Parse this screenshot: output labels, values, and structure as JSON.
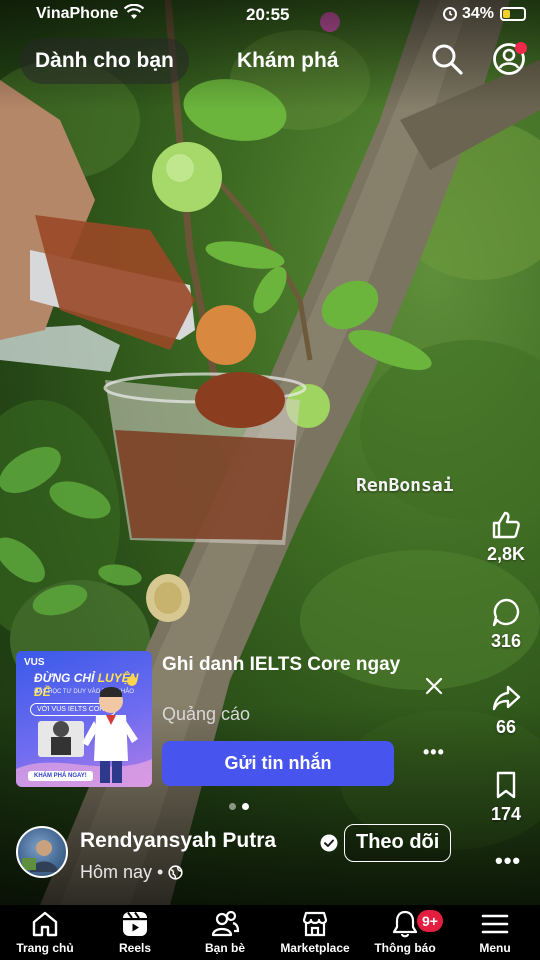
{
  "status_bar": {
    "carrier": "VinaPhone",
    "time": "20:55",
    "battery_percent": "34%",
    "battery_level": 0.34,
    "icons": [
      "wifi-icon",
      "alarm-icon",
      "battery-icon"
    ]
  },
  "top_tabs": {
    "for_you": "Dành cho bạn",
    "explore": "Khám phá",
    "icons": [
      "search-icon",
      "profile-icon"
    ]
  },
  "video": {
    "watermark": "RenBonsai"
  },
  "actions": {
    "like_count": "2,8K",
    "comment_count": "316",
    "share_count": "66",
    "save_count": "174",
    "icons": [
      "like-icon",
      "comment-icon",
      "share-icon",
      "save-icon",
      "more-icon"
    ]
  },
  "ad": {
    "thumb_brand": "VUS",
    "thumb_headline_a": "ĐỪNG CHỈ ",
    "thumb_headline_b": "LUYỆN ĐỀ",
    "thumb_subtext": "HÃY HỌC TƯ DUY VÀO ĐÂM KHẢO",
    "thumb_pill": "VỚI VUS IELTS CORE",
    "thumb_cta": "KHÁM PHÁ NGAY!",
    "title": "Ghi danh IELTS Core ngay",
    "sponsor": "Quảng cáo",
    "button": "Gửi tin nhắn",
    "carousel_pages": 2,
    "carousel_active": 2
  },
  "author": {
    "name": "Rendyansyah Putra",
    "follow": "Theo dõi",
    "posted": "Hôm nay •",
    "verified": true
  },
  "bottom_nav": {
    "items": [
      {
        "label": "Trang chủ",
        "icon": "home-icon"
      },
      {
        "label": "Reels",
        "icon": "reels-icon"
      },
      {
        "label": "Bạn bè",
        "icon": "friends-icon"
      },
      {
        "label": "Marketplace",
        "icon": "marketplace-icon"
      },
      {
        "label": "Thông báo",
        "icon": "bell-icon",
        "badge": "9+"
      },
      {
        "label": "Menu",
        "icon": "menu-icon"
      }
    ]
  },
  "colors": {
    "accent_button": "#4854ee",
    "badge_red": "#e41e3f",
    "battery_yellow": "#f2d02c"
  }
}
